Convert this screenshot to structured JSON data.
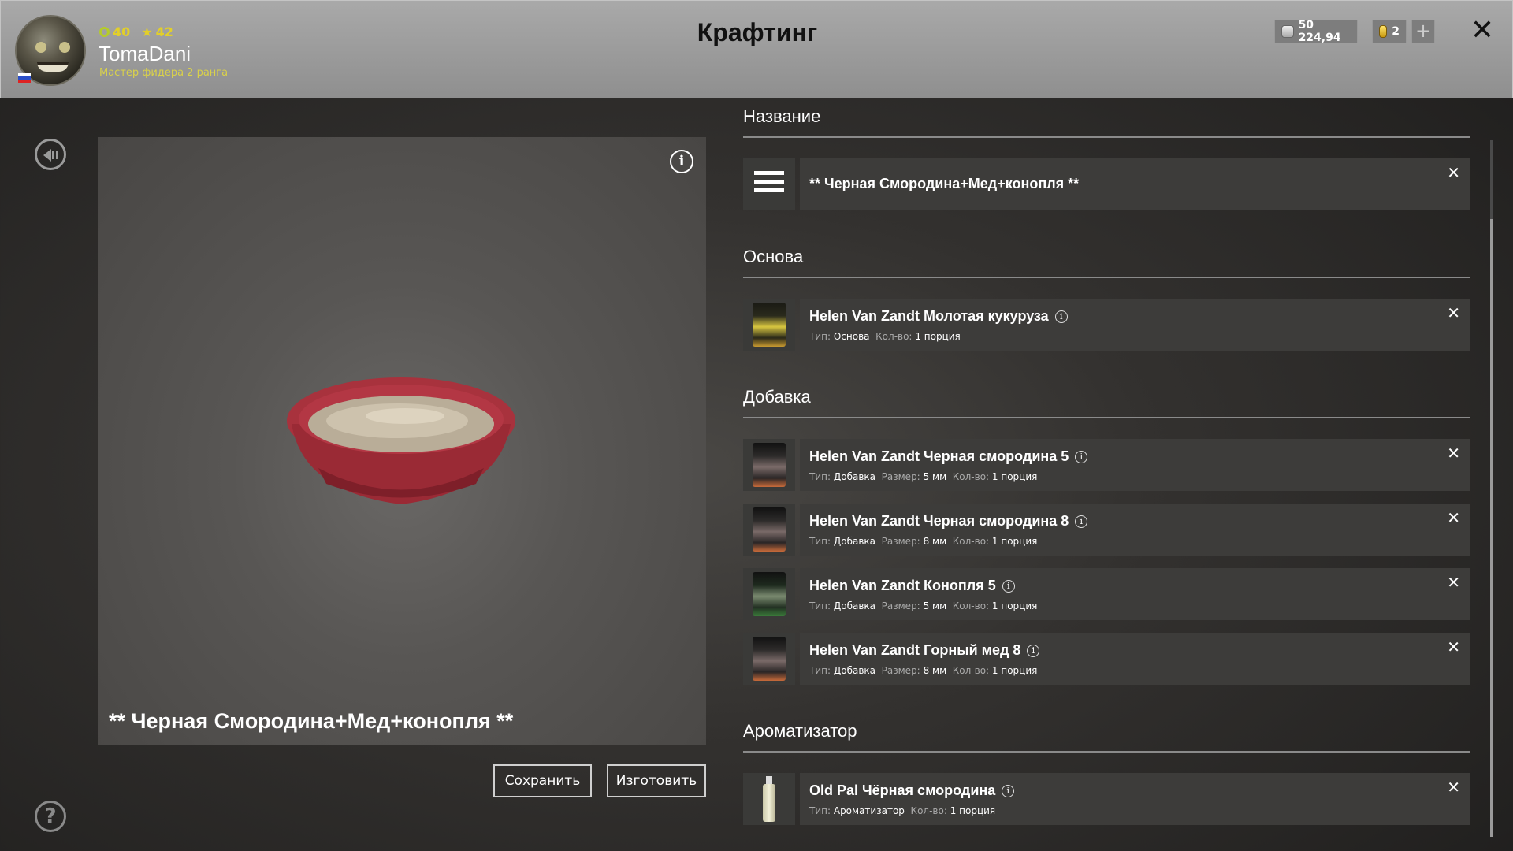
{
  "header": {
    "title": "Крафтинг",
    "user": {
      "level": "40",
      "stars": "42",
      "name": "TomaDani",
      "rank": "Мастер фидера 2 ранга"
    },
    "currency": {
      "silver": "50 224,94",
      "gold": "2"
    },
    "icons": [
      "avatar",
      "flag-icon",
      "level-icon",
      "star-icon",
      "silver-coin-icon",
      "gold-coin-icon",
      "plus-icon",
      "close-icon"
    ]
  },
  "preview": {
    "name": "** Черная Смородина+Мед+конопля **",
    "save_label": "Сохранить",
    "craft_label": "Изготовить"
  },
  "sections": {
    "name_title": "Название",
    "base_title": "Основа",
    "additive_title": "Добавка",
    "flavor_title": "Ароматизатор"
  },
  "recipe_name": "** Черная Смородина+Мед+конопля **",
  "labels": {
    "type": "Тип:",
    "size": "Размер:",
    "qty": "Кол-во:"
  },
  "base": [
    {
      "name": "Helen Van Zandt Молотая кукуруза",
      "type": "Основа",
      "qty": "1 порция"
    }
  ],
  "additives": [
    {
      "name": "Helen Van Zandt Черная смородина 5",
      "type": "Добавка",
      "size": "5 мм",
      "qty": "1 порция"
    },
    {
      "name": "Helen Van Zandt Черная смородина 8",
      "type": "Добавка",
      "size": "8 мм",
      "qty": "1 порция"
    },
    {
      "name": "Helen Van Zandt Конопля 5",
      "type": "Добавка",
      "size": "5 мм",
      "qty": "1 порция"
    },
    {
      "name": "Helen Van Zandt Горный мед 8",
      "type": "Добавка",
      "size": "8 мм",
      "qty": "1 порция"
    }
  ],
  "flavors": [
    {
      "name": "Old Pal Чёрная смородина",
      "type": "Ароматизатор",
      "qty": "1 порция"
    }
  ],
  "glyphs": {
    "close": "✕",
    "remove": "✕",
    "plus": "+",
    "info": "i",
    "help": "?"
  }
}
